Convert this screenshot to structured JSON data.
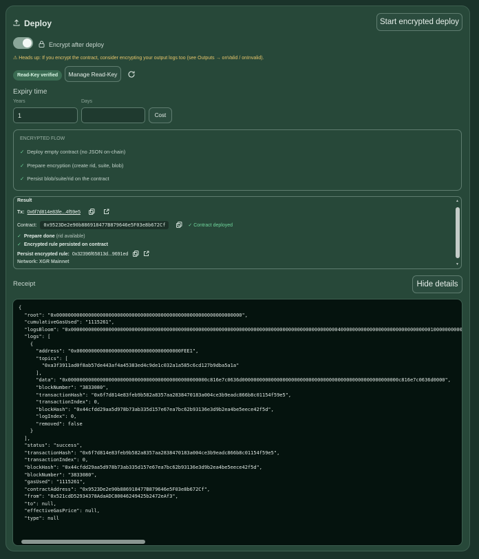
{
  "header": {
    "title": "Deploy",
    "start_button": "Start encrypted deploy"
  },
  "encrypt": {
    "toggle_label": "Encrypt after deploy",
    "toggle_on": true,
    "warning": "⚠ Heads up: If you encrypt the contract, consider encrypting your output logs too (see Outputs → onValid / onInvalid)."
  },
  "readkey": {
    "badge": "Read-Key verified",
    "manage_button": "Manage Read-Key"
  },
  "expiry": {
    "title": "Expiry time",
    "years_label": "Years",
    "years_value": "1",
    "days_label": "Days",
    "days_value": "",
    "cost_button": "Cost"
  },
  "flow": {
    "header": "ENCRYPTED FLOW",
    "steps": [
      "Deploy empty contract (no JSON on-chain)",
      "Prepare encryption (create rid, suite, blob)",
      "Persist blob/suite/rid on the contract"
    ]
  },
  "result": {
    "title": "Result",
    "tx_label": "Tx:",
    "tx_hash": "0x6f7d814e83fe...4f59e5",
    "contract_label": "Contract:",
    "contract_address": "0x9523De2e90b886918477B879646e5F03e8b672Cf",
    "contract_status": "✓ Contract deployed",
    "prepare_done": "Prepare done",
    "prepare_note": "(rid available)",
    "persisted": "Encrypted rule persisted on contract",
    "persist_label": "Persist encrypted rule:",
    "persist_hash": "0x32396f65813d...9691ed",
    "network": "Network: XGR Mainnet"
  },
  "receipt": {
    "label": "Receipt",
    "toggle_button": "Hide details",
    "json_text": "{\n  \"root\": \"0x0000000000000000000000000000000000000000000000000000000000000000\",\n  \"cumulativeGasUsed\": \"1115261\",\n  \"logsBloom\": \"0x00000000000000000000000000000000000000000000000000000000000000000000000000000000000000000000400000000000000000000000000000001000000000000000000000000000000000000000\",\n  \"logs\": [\n    {\n      \"address\": \"0x000000000000000000000000000000000000FEE1\",\n      \"topics\": [\n        \"0xa3f3911ad0f8ab57de443af4a45383ed4c9de1c032a1a585c6cd127b9dba5a1a\"\n      ],\n      \"data\": \"0x000000000000000000000000000000000000000000000000c816e7c0636d000000000000000000000000000000000000000000000000000000c816e7c0636d0000\",\n      \"blockNumber\": \"3833080\",\n      \"transactionHash\": \"0x6f7d814e83feb9b582a8357aa2838470183a004ce3b9eadc866b8c01154f59e5\",\n      \"transactionIndex\": 0,\n      \"blockHash\": \"0x44cfdd29aa5d978b73ab335d157e67ea7bc62b93136e3d9b2ea4be5eece42f5d\",\n      \"logIndex\": 0,\n      \"removed\": false\n    }\n  ],\n  \"status\": \"success\",\n  \"transactionHash\": \"0x6f7d814e83feb9b582a8357aa2838470183a004ce3b9eadc866b8c01154f59e5\",\n  \"transactionIndex\": 0,\n  \"blockHash\": \"0x44cfdd29aa5d978b73ab335d157e67ea7bc62b93136e3d9b2ea4be5eece42f5d\",\n  \"blockNumber\": \"3833080\",\n  \"gasUsed\": \"1115261\",\n  \"contractAddress\": \"0x9523De2e90b886918477B879646e5F03e8b672Cf\",\n  \"from\": \"0x521cdD52934378AdaADC80046249425b2472eAf3\",\n  \"to\": null,\n  \"effectiveGasPrice\": null,\n  \"type\": null"
  },
  "icons": {
    "deploy": "upload-icon",
    "lock": "lock-icon",
    "refresh": "refresh-icon",
    "copy": "copy-icon",
    "external": "external-link-icon"
  },
  "colors": {
    "background": "#1a332a",
    "card": "#274839",
    "accent_success": "#6fd49b",
    "warning": "#e5c46a",
    "code_bg": "#05130e"
  }
}
